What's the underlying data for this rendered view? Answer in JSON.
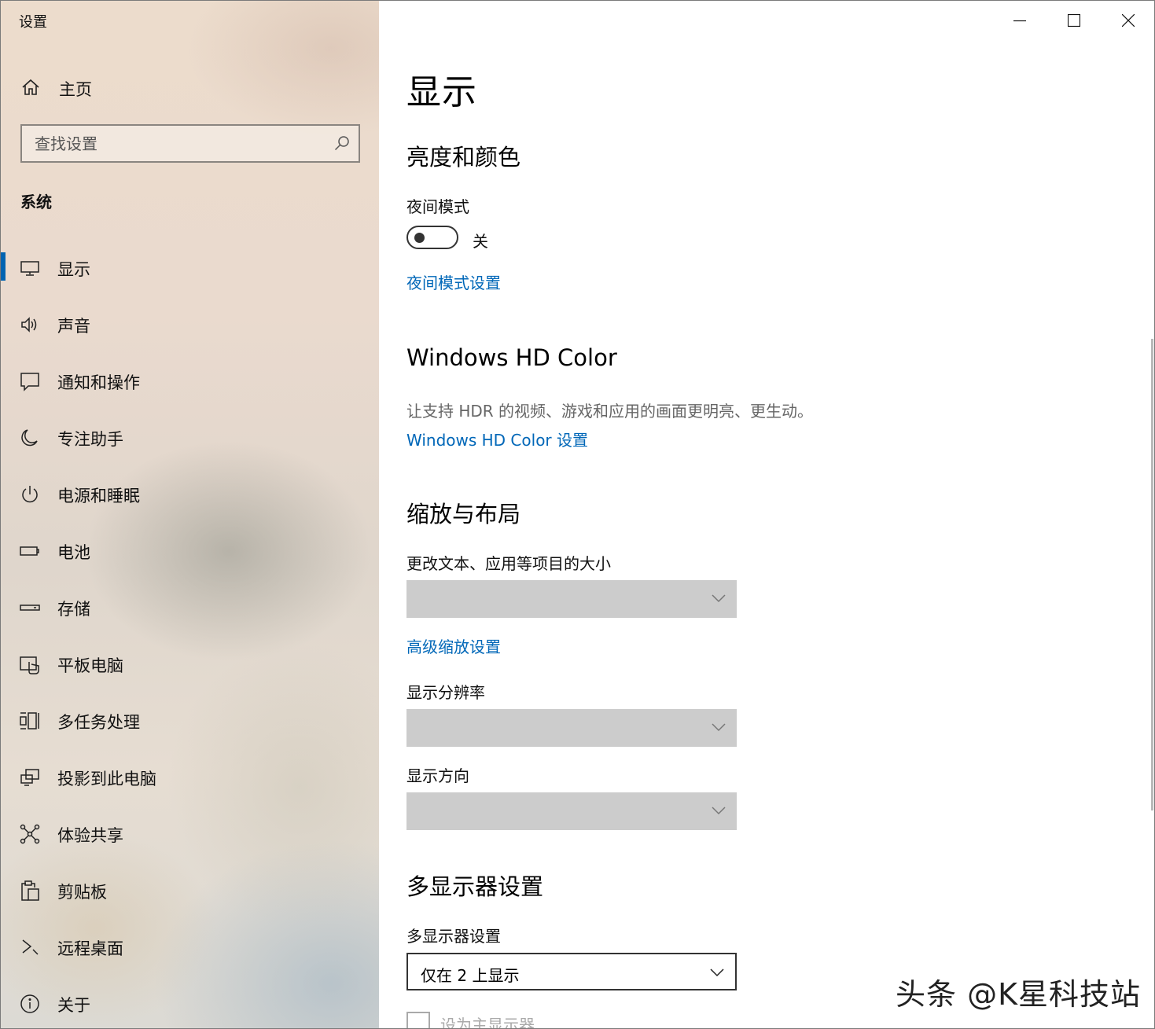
{
  "window": {
    "title": "设置"
  },
  "sidebar": {
    "home_label": "主页",
    "search_placeholder": "查找设置",
    "section_title": "系统",
    "accent_color": "#0063b1",
    "items": [
      {
        "label": "显示",
        "icon": "monitor-icon",
        "active": true
      },
      {
        "label": "声音",
        "icon": "speaker-icon",
        "active": false
      },
      {
        "label": "通知和操作",
        "icon": "notification-icon",
        "active": false
      },
      {
        "label": "专注助手",
        "icon": "moon-icon",
        "active": false
      },
      {
        "label": "电源和睡眠",
        "icon": "power-icon",
        "active": false
      },
      {
        "label": "电池",
        "icon": "battery-icon",
        "active": false
      },
      {
        "label": "存储",
        "icon": "storage-icon",
        "active": false
      },
      {
        "label": "平板电脑",
        "icon": "tablet-icon",
        "active": false
      },
      {
        "label": "多任务处理",
        "icon": "multitask-icon",
        "active": false
      },
      {
        "label": "投影到此电脑",
        "icon": "project-icon",
        "active": false
      },
      {
        "label": "体验共享",
        "icon": "share-icon",
        "active": false
      },
      {
        "label": "剪贴板",
        "icon": "clipboard-icon",
        "active": false
      },
      {
        "label": "远程桌面",
        "icon": "remote-icon",
        "active": false
      },
      {
        "label": "关于",
        "icon": "info-icon",
        "active": false
      }
    ]
  },
  "main": {
    "title": "显示",
    "brightness": {
      "heading": "亮度和颜色",
      "night_mode_label": "夜间模式",
      "night_mode_state": "关",
      "night_mode_on": false,
      "night_mode_link": "夜间模式设置"
    },
    "hdr": {
      "heading": "Windows HD Color",
      "description": "让支持 HDR 的视频、游戏和应用的画面更明亮、更生动。",
      "link": "Windows HD Color 设置"
    },
    "scale": {
      "heading": "缩放与布局",
      "size_label": "更改文本、应用等项目的大小",
      "size_value": "",
      "advanced_link": "高级缩放设置",
      "resolution_label": "显示分辨率",
      "resolution_value": "",
      "orientation_label": "显示方向",
      "orientation_value": ""
    },
    "multi": {
      "heading": "多显示器设置",
      "label": "多显示器设置",
      "value": "仅在 2 上显示",
      "primary_checkbox_label": "设为主显示器",
      "primary_checked": false
    },
    "link_color": "#0067b8"
  },
  "watermark": "头条 @K星科技站"
}
